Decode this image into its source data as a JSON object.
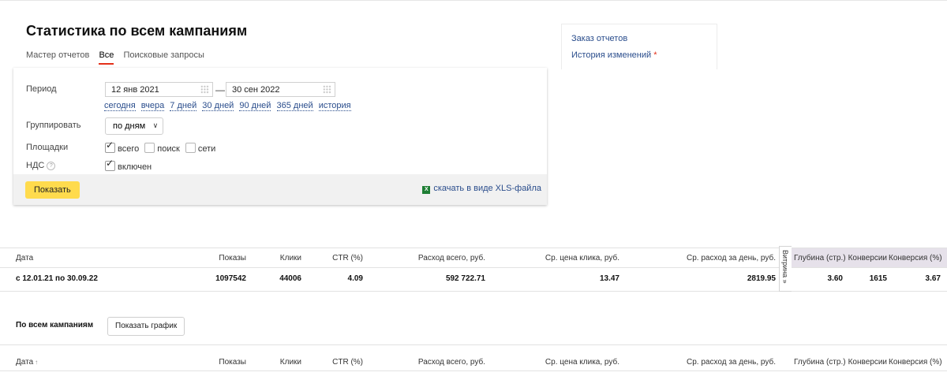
{
  "page": {
    "title": "Статистика по всем кампаниям",
    "tabs": [
      "Мастер отчетов",
      "Все",
      "Поисковые запросы"
    ],
    "active_tab": "Все"
  },
  "side_links": {
    "order_reports": "Заказ отчетов",
    "history": "История изменений",
    "history_mark": "*"
  },
  "form": {
    "period_label": "Период",
    "date_from": "12 янв 2021",
    "date_to": "30 сен 2022",
    "dash": "—",
    "quick_periods": [
      "сегодня",
      "вчера",
      "7 дней",
      "30 дней",
      "90 дней",
      "365 дней",
      "история"
    ],
    "group_label": "Группировать",
    "group_value": "по дням",
    "group_chevron": "∨",
    "platforms_label": "Площадки",
    "platforms": [
      {
        "label": "всего",
        "checked": true
      },
      {
        "label": "поиск",
        "checked": false
      },
      {
        "label": "сети",
        "checked": false
      }
    ],
    "vat_label": "НДС",
    "vat_help": "?",
    "vat_option": {
      "label": "включен",
      "checked": true
    },
    "show_button": "Показать",
    "xls_link": "скачать в виде XLS-файла",
    "xls_icon": "xls-file-icon"
  },
  "summary": {
    "columns": [
      "Дата",
      "Показы",
      "Клики",
      "CTR (%)",
      "Расход всего, руб.",
      "Ср. цена клика, руб.",
      "Ср. расход за день, руб.",
      "Глубина (стр.)",
      "Конверсии",
      "Конверсия (%)"
    ],
    "row": [
      "с 12.01.21 по 30.09.22",
      "1097542",
      "44006",
      "4.09",
      "592 722.71",
      "13.47",
      "2819.95",
      "3.60",
      "1615",
      "3.67"
    ],
    "vitrina": "Витрина »"
  },
  "campaigns": {
    "title": "По всем кампаниям",
    "graph_button": "Показать график",
    "columns": [
      "Дата",
      "Показы",
      "Клики",
      "CTR (%)",
      "Расход всего, руб.",
      "Ср. цена клика, руб.",
      "Ср. расход за день, руб.",
      "Глубина (стр.)",
      "Конверсии",
      "Конверсия (%)"
    ],
    "sort_icon": "↑"
  }
}
